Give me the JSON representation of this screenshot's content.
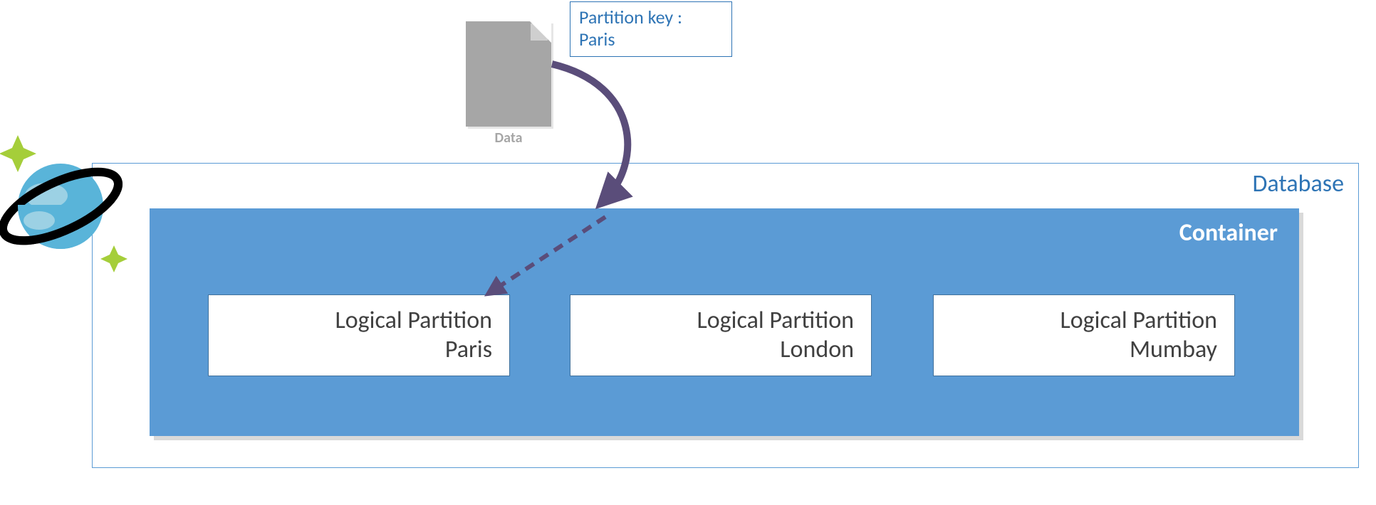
{
  "database": {
    "label": "Database"
  },
  "container": {
    "label": "Container"
  },
  "partitions": {
    "p1": {
      "line1": "Logical Partition",
      "line2": "Paris"
    },
    "p2": {
      "line1": "Logical Partition",
      "line2": "London"
    },
    "p3": {
      "line1": "Logical Partition",
      "line2": "Mumbay"
    }
  },
  "document": {
    "caption": "Data"
  },
  "partition_key": {
    "line1": "Partition key :",
    "line2": "Paris"
  }
}
